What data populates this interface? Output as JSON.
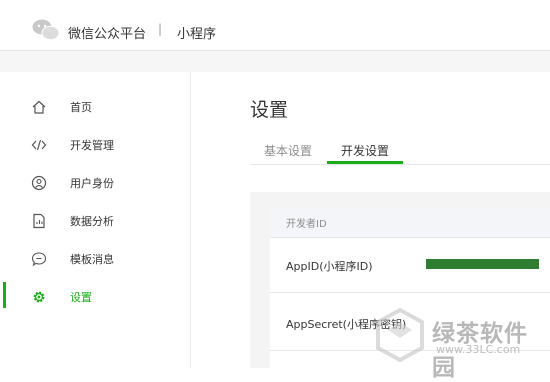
{
  "header": {
    "brand": "微信公众平台",
    "separator": "|",
    "product": "小程序"
  },
  "sidebar": {
    "items": [
      {
        "label": "首页",
        "icon": "home-icon"
      },
      {
        "label": "开发管理",
        "icon": "code-icon"
      },
      {
        "label": "用户身份",
        "icon": "user-icon"
      },
      {
        "label": "数据分析",
        "icon": "document-chart-icon"
      },
      {
        "label": "模板消息",
        "icon": "message-icon"
      },
      {
        "label": "设置",
        "icon": "gear-icon",
        "active": true
      }
    ]
  },
  "page": {
    "title": "设置",
    "tabs": [
      {
        "label": "基本设置",
        "active": false
      },
      {
        "label": "开发设置",
        "active": true
      }
    ]
  },
  "developer_card": {
    "header": "开发者ID",
    "rows": [
      {
        "label": "AppID(小程序ID)"
      },
      {
        "label": "AppSecret(小程序密钥)"
      }
    ]
  },
  "watermark": {
    "text": "绿茶软件园",
    "url": "www.33LC.com"
  },
  "colors": {
    "accent": "#1aad19",
    "redaction": "#2e7d32"
  }
}
